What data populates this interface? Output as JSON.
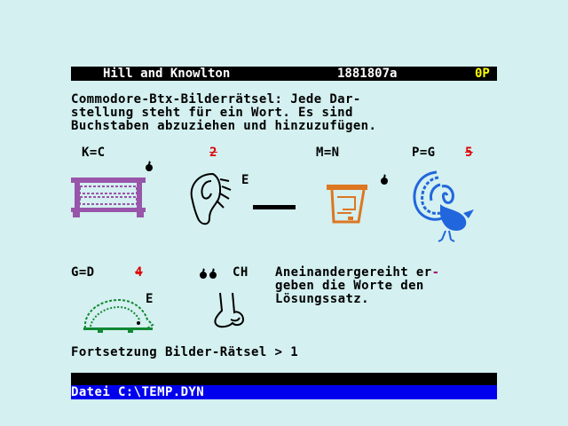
{
  "header": {
    "provider": "Hill and Knowlton",
    "page_number": "1881807a",
    "price": "0P"
  },
  "intro": {
    "line1": "Commodore-Btx-Bilderrätsel: Jede Dar-",
    "line2": "stellung steht für ein Wort. Es sind",
    "line3": "Buchstaben abzuziehen und hinzuzufügen."
  },
  "puzzle": {
    "label_kc": "K=C",
    "label_2": "2",
    "label_e1": "E",
    "label_mn": "M=N",
    "label_pg": "P=G",
    "label_5": "5",
    "label_gd": "G=D",
    "label_4": "4",
    "label_e2": "E",
    "label_ch": "CH"
  },
  "hint": {
    "line1a": "Aneinandergereiht er",
    "line1b": "-",
    "line2": "geben die Worte den",
    "line3": "Lösungssatz."
  },
  "continuation": "Fortsetzung Bilder-Rätsel > 1",
  "status": {
    "text": "Datei C:\\TEMP.DYN"
  },
  "colors": {
    "background": "#d4f0f0",
    "header_bg": "#000000",
    "header_text": "#ffffff",
    "price_text": "#ffff00",
    "status_bg": "#0000ee",
    "red_digits": "#dd0000",
    "chest": "#9955aa",
    "hedgehog": "#118833",
    "turkey": "#2266dd",
    "pot": "#dd7722"
  }
}
